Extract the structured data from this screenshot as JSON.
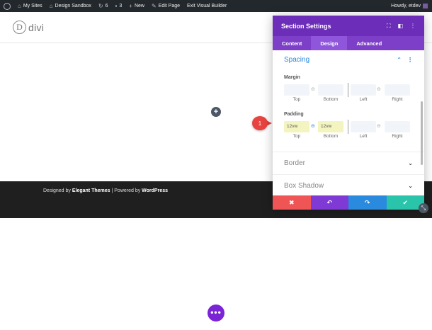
{
  "admin_bar": {
    "my_sites": "My Sites",
    "site_name": "Design Sandbox",
    "updates_count": "6",
    "comments_count": "3",
    "new_label": "New",
    "edit_page": "Edit Page",
    "exit_builder": "Exit Visual Builder",
    "howdy": "Howdy, etdev"
  },
  "header": {
    "logo_letter": "D",
    "logo_text": "divi"
  },
  "footer": {
    "designed_by_prefix": "Designed by ",
    "designed_by_brand": "Elegant Themes",
    "separator": " | Powered by ",
    "powered_by": "WordPress"
  },
  "modal": {
    "title": "Section Settings",
    "tabs": [
      "Content",
      "Design",
      "Advanced"
    ],
    "active_tab": "Design",
    "spacing": {
      "title": "Spacing",
      "margin_label": "Margin",
      "padding_label": "Padding",
      "captions": [
        "Top",
        "Bottom",
        "Left",
        "Right"
      ],
      "padding_top": "12vw",
      "padding_bottom": "12vw"
    },
    "border_label": "Border",
    "box_shadow_label": "Box Shadow"
  },
  "badge": "1",
  "colors": {
    "modal_header": "#6c2eb9",
    "modal_tabs": "#7d3fc8",
    "accent_blue": "#2b87da",
    "cancel": "#ef5555",
    "undo": "#7f39d4",
    "redo": "#2a8ade",
    "save": "#29c4a9",
    "badge": "#e8433e"
  }
}
